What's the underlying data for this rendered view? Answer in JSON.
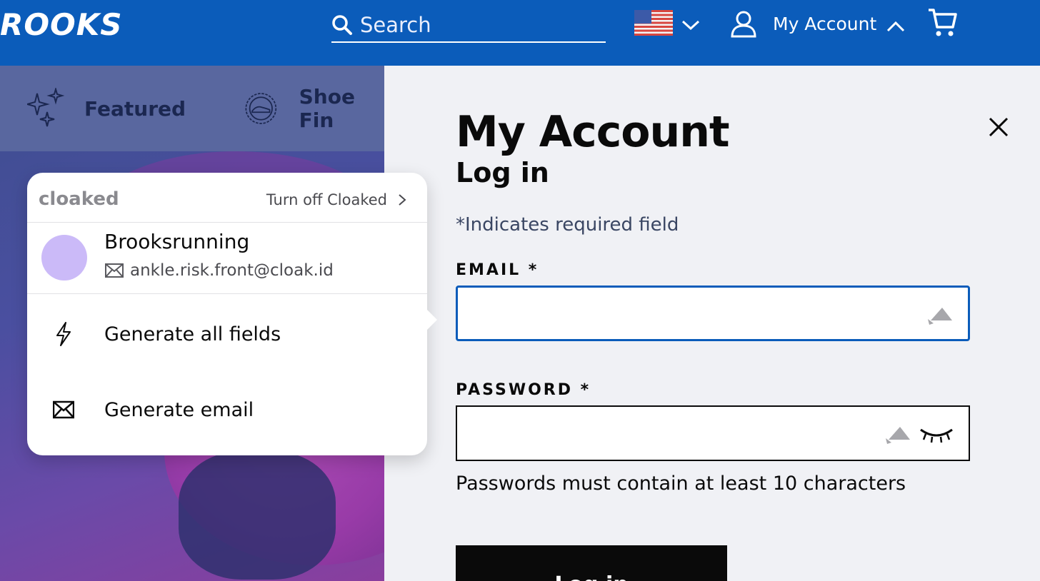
{
  "header": {
    "logo_text": "ROOKS",
    "search_placeholder": "Search",
    "account_label": "My Account",
    "brand_color": "#0b5cba"
  },
  "nav": {
    "items": [
      {
        "label": "Featured",
        "icon": "sparkles-icon"
      },
      {
        "label": "Shoe Fin",
        "icon": "badge-shoe-icon"
      }
    ]
  },
  "panel": {
    "title": "My Account",
    "subtitle": "Log in",
    "required_note": "*Indicates required field",
    "email_label": "EMAIL *",
    "password_label": "PASSWORD *",
    "password_hint": "Passwords must contain at least 10 characters",
    "login_button": "Log in"
  },
  "cloaked": {
    "brand": "cloaked",
    "turn_off": "Turn off Cloaked",
    "identity_name": "Brooksrunning",
    "identity_email": "ankle.risk.front@cloak.id",
    "actions": [
      {
        "label": "Generate all fields",
        "icon": "lightning-icon"
      },
      {
        "label": "Generate email",
        "icon": "envelope-icon"
      }
    ]
  }
}
